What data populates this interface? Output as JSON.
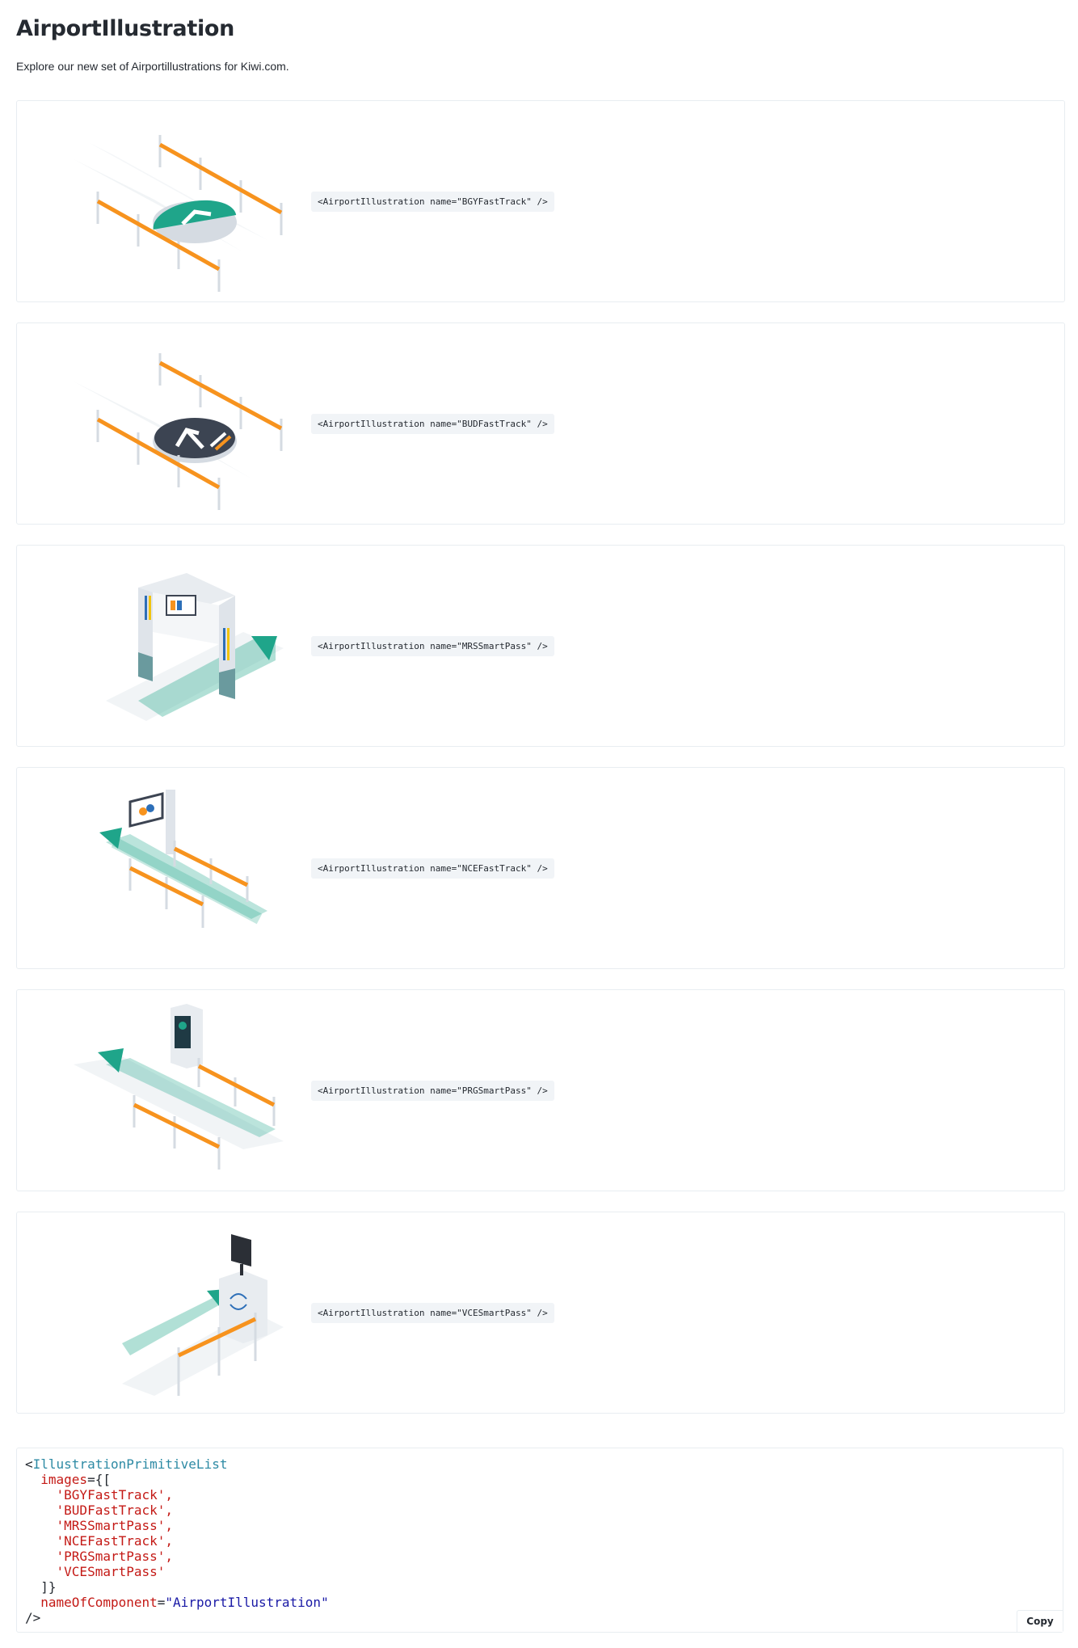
{
  "page": {
    "title": "AirportIllustration",
    "subtitle": "Explore our new set of Airportillustrations for Kiwi.com."
  },
  "cards": [
    {
      "name": "BGYFastTrack",
      "code": "<AirportIllustration name=\"BGYFastTrack\" />"
    },
    {
      "name": "BUDFastTrack",
      "code": "<AirportIllustration name=\"BUDFastTrack\" />"
    },
    {
      "name": "MRSSmartPass",
      "code": "<AirportIllustration name=\"MRSSmartPass\" />"
    },
    {
      "name": "NCEFastTrack",
      "code": "<AirportIllustration name=\"NCEFastTrack\" />"
    },
    {
      "name": "PRGSmartPass",
      "code": "<AirportIllustration name=\"PRGSmartPass\" />"
    },
    {
      "name": "VCESmartPass",
      "code": "<AirportIllustration name=\"VCESmartPass\" />"
    }
  ],
  "code": {
    "open": "<",
    "component": "IllustrationPrimitiveList",
    "images_attr": "images",
    "images_open": "={[",
    "images": [
      "'BGYFastTrack',",
      "'BUDFastTrack',",
      "'MRSSmartPass',",
      "'NCEFastTrack',",
      "'PRGSmartPass',",
      "'VCESmartPass'"
    ],
    "images_close": "]}",
    "name_attr": "nameOfComponent",
    "name_eq": "=",
    "name_value": "\"AirportIllustration\"",
    "close": "/>",
    "copy_label": "Copy"
  },
  "colors": {
    "orange": "#f7931e",
    "teal": "#1fa58a",
    "dark": "#3c4452",
    "rail": "#d5dbe2"
  }
}
